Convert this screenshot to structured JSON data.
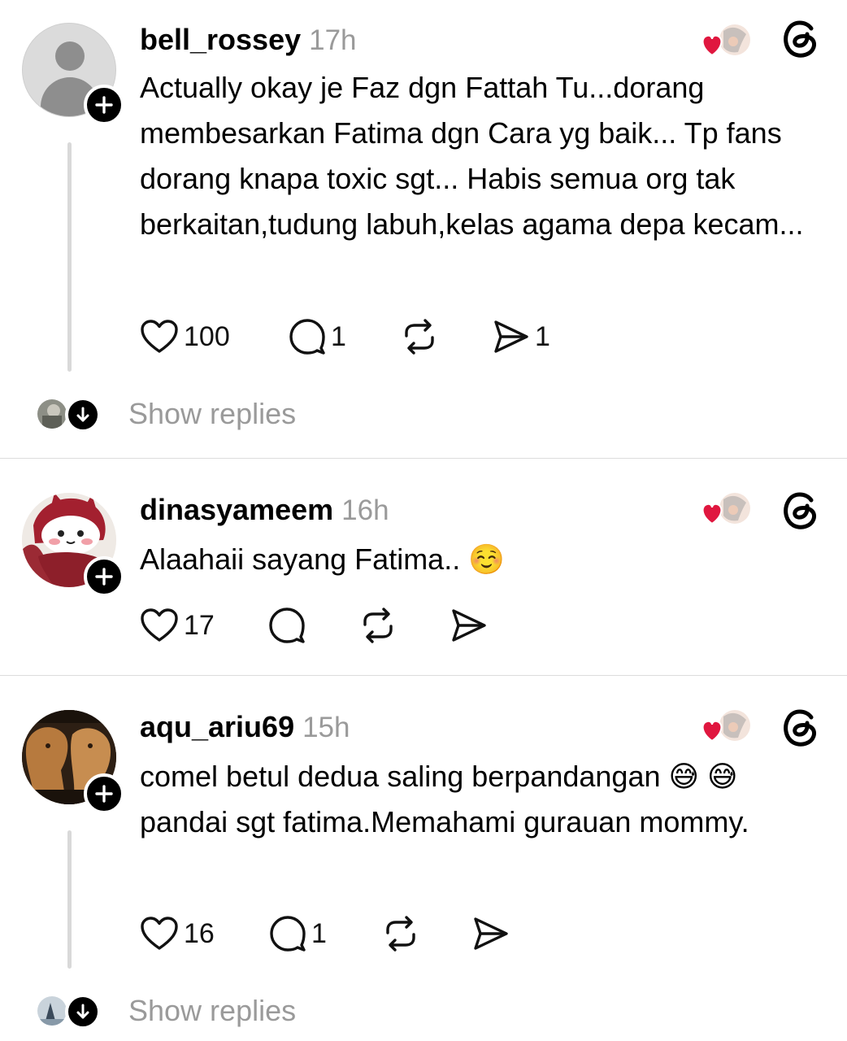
{
  "posts": [
    {
      "username": "bell_rossey",
      "time": "17h",
      "text": "Actually okay je Faz dgn Fattah Tu...dorang membesarkan Fatima dgn Cara yg baik... Tp fans dorang knapa toxic sgt... Habis semua org tak berkaitan,tudung labuh,kelas agama depa kecam...",
      "likes": "100",
      "replies": "1",
      "reposts": "",
      "shares": "1",
      "show_replies": "Show replies"
    },
    {
      "username": "dinasyameem",
      "time": "16h",
      "text": "Alaahaii sayang Fatima.. ☺️",
      "likes": "17",
      "replies": "",
      "reposts": "",
      "shares": ""
    },
    {
      "username": "aqu_ariu69",
      "time": "15h",
      "text": "comel betul dedua saling berpandangan 😅 😅 pandai sgt fatima.Memahami gurauan mommy.",
      "likes": "16",
      "replies": "1",
      "reposts": "",
      "shares": "",
      "show_replies": "Show replies"
    }
  ],
  "icons": {
    "like": "heart-outline-icon",
    "reply": "speech-bubble-icon",
    "repost": "repost-arrows-icon",
    "share": "paper-plane-icon",
    "liked_by_creator": "heart-avatar-icon",
    "threads": "threads-logo-icon",
    "follow": "plus-icon",
    "expand": "arrow-down-icon"
  },
  "colors": {
    "text": "#000000",
    "muted": "#9a9a9a",
    "heart_red": "#e0173f",
    "divider": "#dcdcdc"
  }
}
